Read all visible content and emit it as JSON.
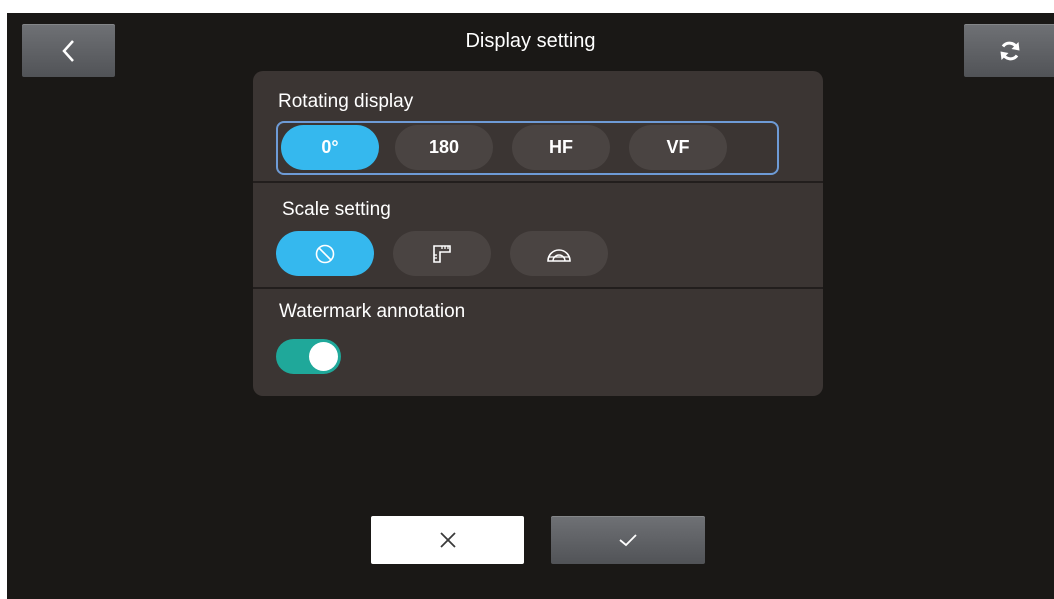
{
  "header": {
    "title": "Display setting",
    "back_icon": "chevron-left-icon",
    "refresh_icon": "refresh-icon"
  },
  "rotating_display": {
    "label": "Rotating display",
    "options": [
      "0°",
      "180",
      "HF",
      "VF"
    ],
    "selected": "0°"
  },
  "scale_setting": {
    "label": "Scale setting",
    "options": [
      {
        "icon": "no-scale-icon"
      },
      {
        "icon": "ruler-icon"
      },
      {
        "icon": "protractor-icon"
      }
    ],
    "selected_index": 0
  },
  "watermark": {
    "label": "Watermark annotation",
    "enabled": true
  },
  "footer": {
    "cancel_icon": "close-icon",
    "confirm_icon": "checkmark-icon"
  },
  "colors": {
    "background": "#1a1816",
    "panel": "#3b3533",
    "selected": "#35b8ee",
    "toggle_on": "#1fa89a",
    "group_border": "#6e9bd6"
  }
}
